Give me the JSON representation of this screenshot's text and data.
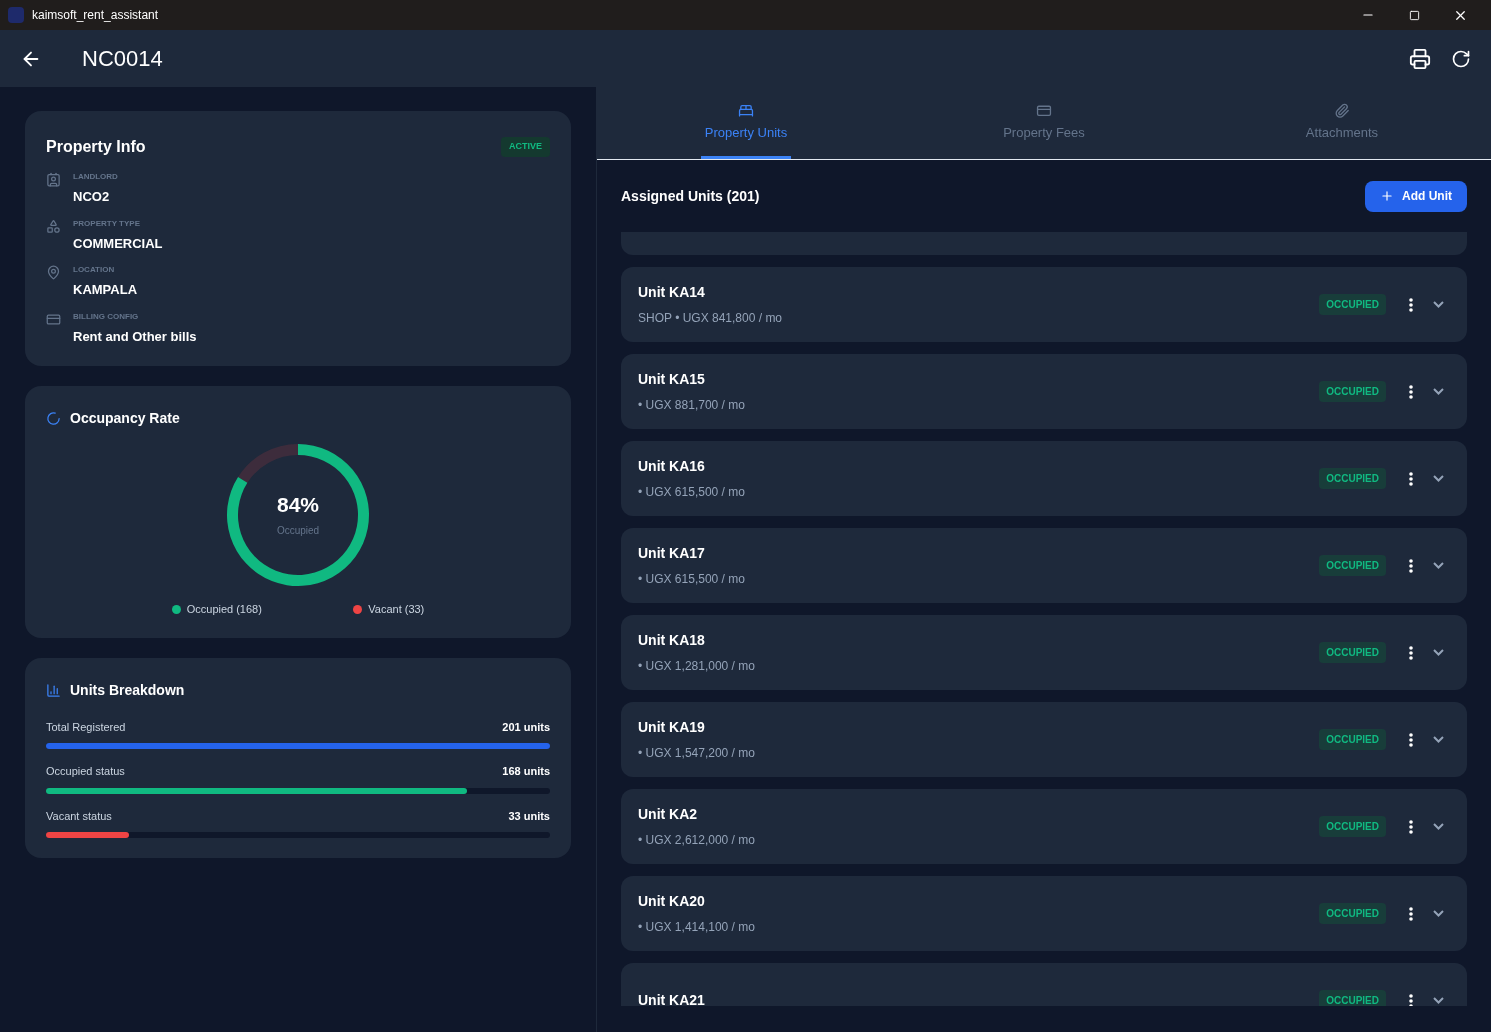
{
  "window": {
    "title": "kaimsoft_rent_assistant"
  },
  "header": {
    "title": "NC0014"
  },
  "property_info": {
    "title": "Property Info",
    "status": "ACTIVE",
    "fields": [
      {
        "kind": "landlord",
        "label": "LANDLORD",
        "value": "NCO2"
      },
      {
        "kind": "type",
        "label": "PROPERTY TYPE",
        "value": "COMMERCIAL"
      },
      {
        "kind": "location",
        "label": "LOCATION",
        "value": "KAMPALA"
      },
      {
        "kind": "billing",
        "label": "BILLING CONFIG",
        "value": "Rent and Other bills"
      }
    ]
  },
  "occupancy": {
    "title": "Occupancy Rate",
    "percent": "84%",
    "caption": "Occupied",
    "chart_data": {
      "type": "donut",
      "categories": [
        "Occupied",
        "Vacant"
      ],
      "series": [
        {
          "values": [
            84,
            16
          ]
        }
      ]
    },
    "legend": [
      {
        "count": "(168)",
        "color": "#10b981"
      },
      {
        "count": "(33)",
        "color": "#ef4444"
      }
    ]
  },
  "breakdown": {
    "title": "Units Breakdown",
    "rows": [
      {
        "label": "Total Registered",
        "value": "201 units",
        "level": 1,
        "color": "#2563eb"
      },
      {
        "label": "Occupied status",
        "value": "168 units",
        "level": 0.836,
        "color": "#10b981"
      },
      {
        "label": "Vacant status",
        "value": "33 units",
        "level": 0.164,
        "color": "#ef4444"
      }
    ]
  },
  "tabs": [
    {
      "label": "Property Units",
      "selected": true
    },
    {
      "label": "Property Fees",
      "selected": false
    },
    {
      "label": "Attachments",
      "selected": false
    }
  ],
  "units": {
    "title": "Assigned Units (201)",
    "add_button": "Add Unit",
    "items": [
      {
        "name": "Unit KA14",
        "detail": "SHOP • UGX 841,800 / mo",
        "status": "OCCUPIED"
      },
      {
        "name": "Unit KA15",
        "detail": "• UGX 881,700 / mo",
        "status": "OCCUPIED"
      },
      {
        "name": "Unit KA16",
        "detail": "• UGX 615,500 / mo",
        "status": "OCCUPIED"
      },
      {
        "name": "Unit KA17",
        "detail": "• UGX 615,500 / mo",
        "status": "OCCUPIED"
      },
      {
        "name": "Unit KA18",
        "detail": "• UGX 1,281,000 / mo",
        "status": "OCCUPIED"
      },
      {
        "name": "Unit KA19",
        "detail": "• UGX 1,547,200 / mo",
        "status": "OCCUPIED"
      },
      {
        "name": "Unit KA2",
        "detail": "• UGX 2,612,000 / mo",
        "status": "OCCUPIED"
      },
      {
        "name": "Unit KA20",
        "detail": "• UGX 1,414,100 / mo",
        "status": "OCCUPIED"
      },
      {
        "name": "Unit KA21",
        "status": "OCCUPIED"
      }
    ]
  }
}
